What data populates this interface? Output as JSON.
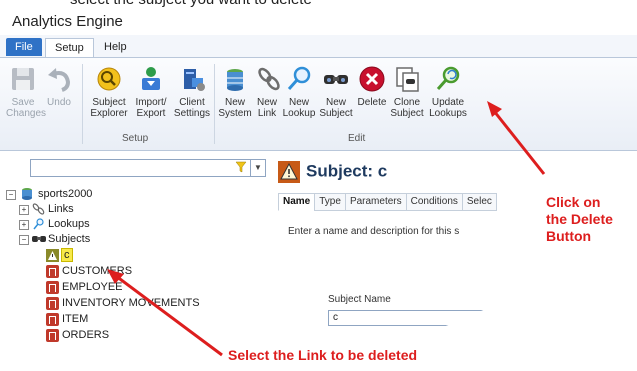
{
  "top_text": "select the subject you want to delete",
  "app": {
    "title": "Analytics Engine"
  },
  "tabs": [
    {
      "label": "File"
    },
    {
      "label": "Setup"
    },
    {
      "label": "Help"
    }
  ],
  "ribbon": {
    "buttons": [
      {
        "label_1": "Save",
        "label_2": "Changes",
        "icon": "save-icon"
      },
      {
        "label_1": "Undo",
        "label_2": "",
        "icon": "undo-icon"
      },
      {
        "label_1": "Subject",
        "label_2": "Explorer",
        "icon": "subject-explorer-icon"
      },
      {
        "label_1": "Import/",
        "label_2": "Export",
        "icon": "import-export-icon"
      },
      {
        "label_1": "Client",
        "label_2": "Settings",
        "icon": "client-settings-icon"
      },
      {
        "label_1": "New",
        "label_2": "System",
        "icon": "new-system-icon"
      },
      {
        "label_1": "New",
        "label_2": "Link",
        "icon": "new-link-icon"
      },
      {
        "label_1": "New",
        "label_2": "Lookup",
        "icon": "new-lookup-icon"
      },
      {
        "label_1": "New",
        "label_2": "Subject",
        "icon": "new-subject-icon"
      },
      {
        "label_1": "Delete",
        "label_2": "",
        "icon": "delete-icon"
      },
      {
        "label_1": "Clone",
        "label_2": "Subject",
        "icon": "clone-subject-icon"
      },
      {
        "label_1": "Update",
        "label_2": "Lookups",
        "icon": "update-lookups-icon"
      }
    ],
    "groups": [
      {
        "label": "Setup"
      },
      {
        "label": "Edit"
      }
    ]
  },
  "tree": {
    "root": "sports2000",
    "folders": [
      {
        "label": "Links"
      },
      {
        "label": "Lookups"
      },
      {
        "label": "Subjects"
      }
    ],
    "subjects": [
      {
        "label": "c"
      },
      {
        "label": "CUSTOMERS"
      },
      {
        "label": "EMPLOYEE"
      },
      {
        "label": "INVENTORY MOVEMENTS"
      },
      {
        "label": "ITEM"
      },
      {
        "label": "ORDERS"
      }
    ]
  },
  "detail": {
    "title": "Subject: c",
    "tabs": [
      {
        "label": "Name"
      },
      {
        "label": "Type"
      },
      {
        "label": "Parameters"
      },
      {
        "label": "Conditions"
      },
      {
        "label": "Selec"
      }
    ],
    "description": "Enter a name and description for this s",
    "subject_name_label": "Subject Name",
    "subject_name_value": "c"
  },
  "annotations": {
    "delete_line_1": "Click on",
    "delete_line_2": "the Delete",
    "delete_line_3": "Button",
    "select_text": "Select the Link to be deleted"
  },
  "colors": {
    "annotation": "#dd1e1e",
    "file_tab": "#2f72c6",
    "delete_button": "#c8102e"
  }
}
